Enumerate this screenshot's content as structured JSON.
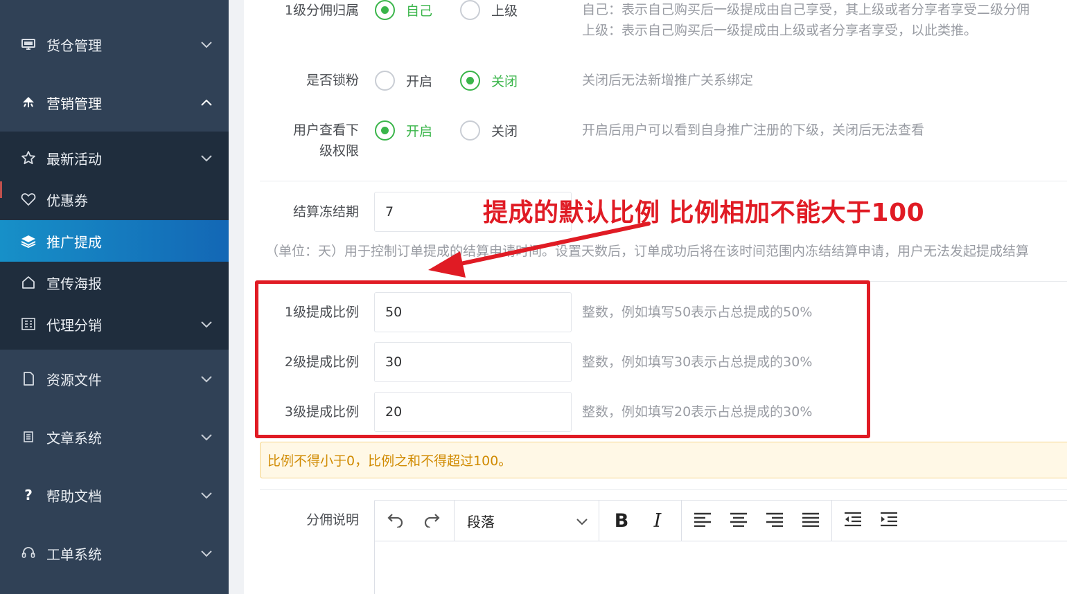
{
  "sidebar": {
    "items": [
      {
        "label": "货仓管理",
        "icon": "monitor-icon",
        "chevron": "down"
      },
      {
        "label": "营销管理",
        "icon": "umbrella-icon",
        "chevron": "up"
      },
      {
        "label": "最新活动",
        "icon": "star-icon",
        "chevron": "down"
      },
      {
        "label": "优惠券",
        "icon": "heart-icon",
        "chevron": ""
      },
      {
        "label": "推广提成",
        "icon": "layers-icon",
        "chevron": "",
        "active": true
      },
      {
        "label": "宣传海报",
        "icon": "home-icon",
        "chevron": ""
      },
      {
        "label": "代理分销",
        "icon": "grid-list-icon",
        "chevron": "down"
      },
      {
        "label": "资源文件",
        "icon": "file-icon",
        "chevron": "down"
      },
      {
        "label": "文章系统",
        "icon": "document-icon",
        "chevron": "down"
      },
      {
        "label": "帮助文档",
        "icon": "question-icon",
        "chevron": "down"
      },
      {
        "label": "工单系统",
        "icon": "headset-icon",
        "chevron": "down"
      }
    ]
  },
  "form": {
    "level1_owner": {
      "label": "1级分佣归属",
      "options": [
        "自己",
        "上级"
      ],
      "selected": "自己",
      "hint_line1": "自己：表示自己购买后一级提成由自己享受，其上级或者分享者享受二级分佣",
      "hint_line2": "上级：表示自己购买后一级提成由上级或者分享者享受，以此类推。"
    },
    "lock_fans": {
      "label": "是否锁粉",
      "options": [
        "开启",
        "关闭"
      ],
      "selected": "关闭",
      "hint": "关闭后无法新增推广关系绑定"
    },
    "view_sub": {
      "label_line1": "用户查看下",
      "label_line2": "级权限",
      "options": [
        "开启",
        "关闭"
      ],
      "selected": "开启",
      "hint": "开启后用户可以看到自身推广注册的下级，关闭后无法查看"
    },
    "freeze_period": {
      "label": "结算冻结期",
      "value": "7",
      "hint": "（单位：天）用于控制订单提成的结算申请时间。设置天数后，订单成功后将在该时间范围内冻结结算申请，用户无法发起提成结算"
    },
    "rates": [
      {
        "label": "1级提成比例",
        "value": "50",
        "hint": "整数，例如填写50表示占总提成的50%"
      },
      {
        "label": "2级提成比例",
        "value": "30",
        "hint": "整数，例如填写30表示占总提成的30%"
      },
      {
        "label": "3级提成比例",
        "value": "20",
        "hint": "整数，例如填写20表示占总提成的30%"
      }
    ],
    "warning": "比例不得小于0，比例之和不得超过100。",
    "desc_label": "分佣说明",
    "editor": {
      "paragraph_select": "段落",
      "bold": "B",
      "italic": "I"
    }
  },
  "annotation": {
    "text": "提成的默认比例 比例相加不能大于100",
    "color": "#e01b24"
  },
  "colors": {
    "sidebar_bg": "#304156",
    "submenu_bg": "#1f2d3d",
    "active_bg": "#1790c8",
    "radio_checked": "#3ab54a"
  }
}
